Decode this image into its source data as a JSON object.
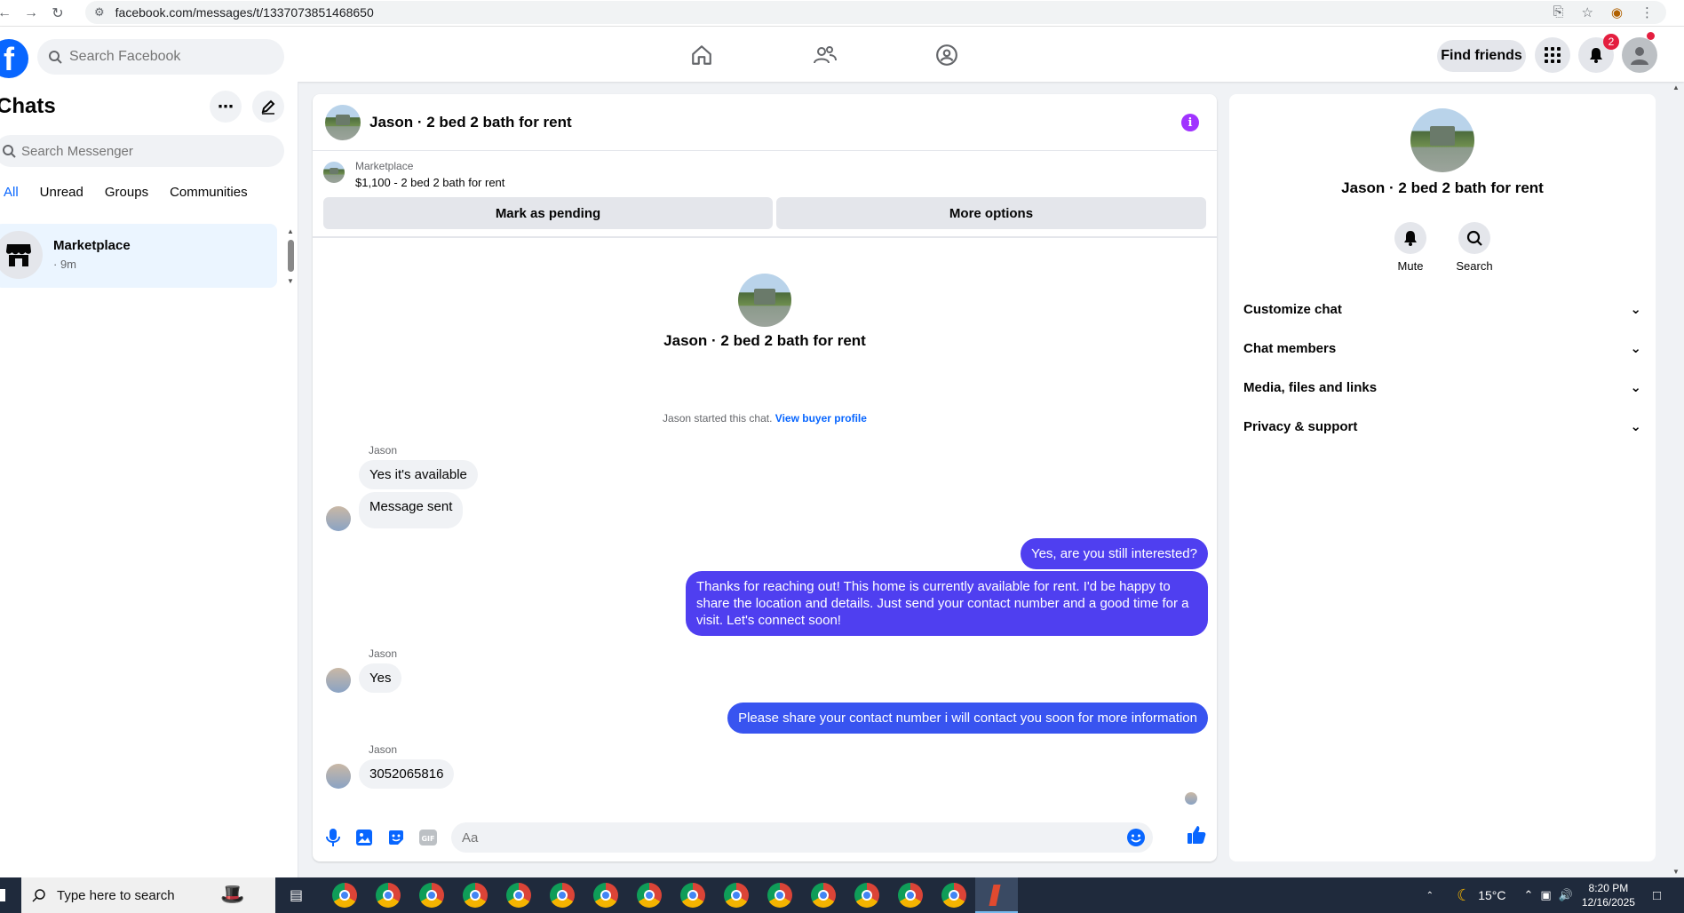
{
  "browser": {
    "url": "facebook.com/messages/t/1337073851468650"
  },
  "header": {
    "search_placeholder": "Search Facebook",
    "find_friends": "Find friends",
    "notification_count": "2"
  },
  "sidebar": {
    "title": "Chats",
    "search_placeholder": "Search Messenger",
    "tabs": [
      "All",
      "Unread",
      "Groups",
      "Communities"
    ],
    "chats": [
      {
        "name": "Marketplace",
        "time": "· 9m"
      }
    ]
  },
  "conversation": {
    "title": "Jason · 2 bed 2 bath for rent",
    "marketplace_label": "Marketplace",
    "listing": "$1,100 - 2 bed 2 bath for rent",
    "mark_pending": "Mark as pending",
    "more_options": "More options",
    "profile_name": "Jason · 2 bed 2 bath for rent",
    "started_text": "Jason started this chat.",
    "view_buyer_profile": "View buyer profile",
    "messages": [
      {
        "from": "Jason",
        "sender_label": "Jason",
        "text": "Yes it's available"
      },
      {
        "from": "Jason",
        "text": "Message sent"
      },
      {
        "from": "me",
        "text": "Yes, are you still interested?"
      },
      {
        "from": "me",
        "text": "Thanks for reaching out! This home is currently available for rent. I'd be happy to share the location and details. Just send your contact number and a good time for a visit. Let's connect soon!"
      },
      {
        "from": "Jason",
        "sender_label": "Jason",
        "text": "Yes"
      },
      {
        "from": "me",
        "text": "Please share your contact number i will contact you soon for more information"
      },
      {
        "from": "Jason",
        "sender_label": "Jason",
        "text": "3052065816"
      }
    ],
    "composer_placeholder": "Aa"
  },
  "right_panel": {
    "name": "Jason · 2 bed 2 bath for rent",
    "mute": "Mute",
    "search": "Search",
    "sections": [
      "Customize chat",
      "Chat members",
      "Media, files and links",
      "Privacy & support"
    ]
  },
  "taskbar": {
    "search_placeholder": "Type here to search",
    "temperature": "15°C",
    "time": "8:20 PM",
    "date": "12/16/2025"
  },
  "colors": {
    "accent": "#0866ff",
    "outgoing_bubble": "#4f3ff0",
    "info": "#a033ff"
  }
}
